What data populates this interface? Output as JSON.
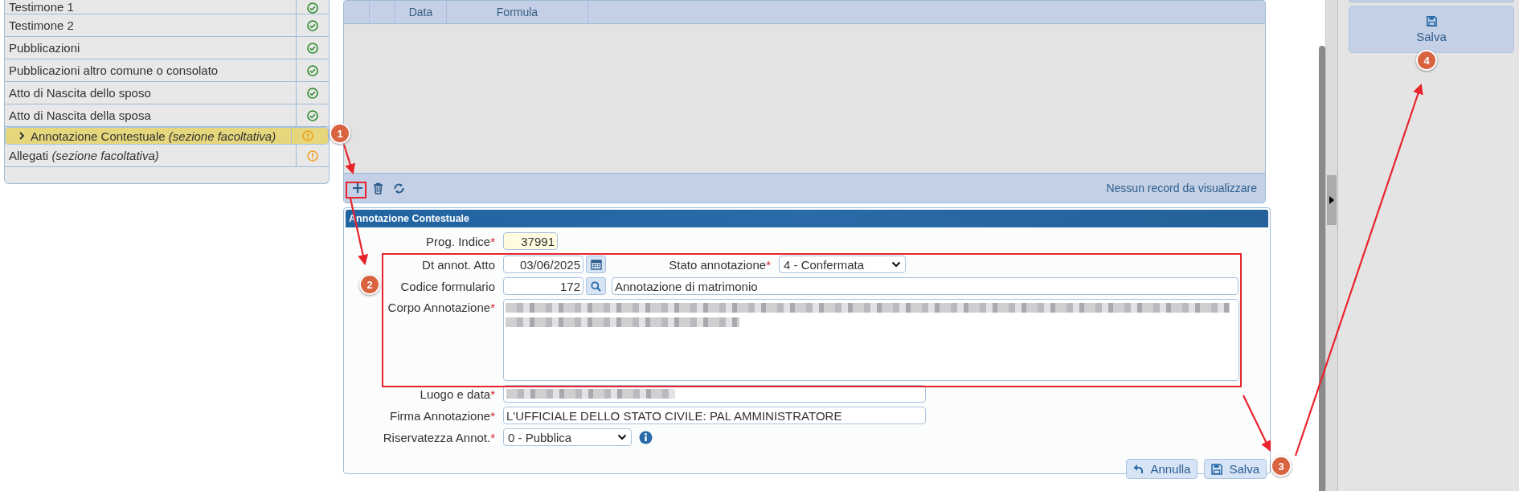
{
  "sections_list": {
    "items": [
      {
        "label": "Testimone 1",
        "kind": "ok",
        "selected": false
      },
      {
        "label": "Testimone 2",
        "kind": "ok",
        "selected": false
      },
      {
        "label": "Pubblicazioni",
        "kind": "ok",
        "selected": false
      },
      {
        "label": "Pubblicazioni altro comune o consolato",
        "kind": "ok",
        "selected": false
      },
      {
        "label": "Atto di Nascita dello sposo",
        "kind": "ok",
        "selected": false
      },
      {
        "label": "Atto di Nascita della sposa",
        "kind": "ok",
        "selected": false
      },
      {
        "label": "Annotazione Contestuale *(sezione facoltativa)*",
        "kind": "warning",
        "selected": true
      },
      {
        "label": "Allegati *(sezione facoltativa)*",
        "kind": "warning",
        "selected": false
      }
    ]
  },
  "grid": {
    "columns": [
      {
        "label": "Data"
      },
      {
        "label": "Formula"
      }
    ],
    "empty_message": "Nessun record da visualizzare"
  },
  "form": {
    "title": "Annotazione Contestuale",
    "rows": [
      {
        "fields": [
          {
            "kind": "index",
            "label": "Prog. Indice",
            "mark": "*",
            "value": "37991"
          }
        ]
      },
      {
        "fields": [
          {
            "kind": "date",
            "label": "Dt annot. Atto",
            "value": "03/06/2025"
          },
          {
            "kind": "select",
            "label": "Stato annotazione",
            "mark": "*",
            "value": "4 - Confermata"
          }
        ]
      },
      {
        "fields": [
          {
            "kind": "lookup",
            "label": "Codice formulario",
            "value": "172",
            "description": "Annotazione di matrimonio"
          }
        ]
      },
      {
        "fields": [
          {
            "kind": "textarea-redacted",
            "label": "Corpo Annotazione",
            "mark": "*"
          }
        ]
      },
      {
        "fields": [
          {
            "kind": "text-redacted",
            "label": "Luogo e data",
            "mark": "*"
          }
        ]
      },
      {
        "fields": [
          {
            "kind": "text",
            "label": "Firma Annotazione",
            "mark": "*",
            "value": "L'UFFICIALE DELLO STATO CIVILE: PAL AMMINISTRATORE"
          }
        ]
      },
      {
        "fields": [
          {
            "kind": "select",
            "label": "Riservatezza Annot.",
            "mark": "*",
            "value": "0 - Pubblica",
            "info": true
          }
        ]
      }
    ],
    "buttons": [
      {
        "label": "Annulla",
        "kind": "cancel"
      },
      {
        "label": "Salva",
        "kind": "save"
      }
    ]
  },
  "side_panel": {
    "buttons": [
      {
        "label": "Salva",
        "kind": "save"
      }
    ]
  },
  "annotations": {
    "markers": [
      {
        "number": "1"
      },
      {
        "number": "2"
      },
      {
        "number": "3"
      },
      {
        "number": "4"
      }
    ]
  }
}
